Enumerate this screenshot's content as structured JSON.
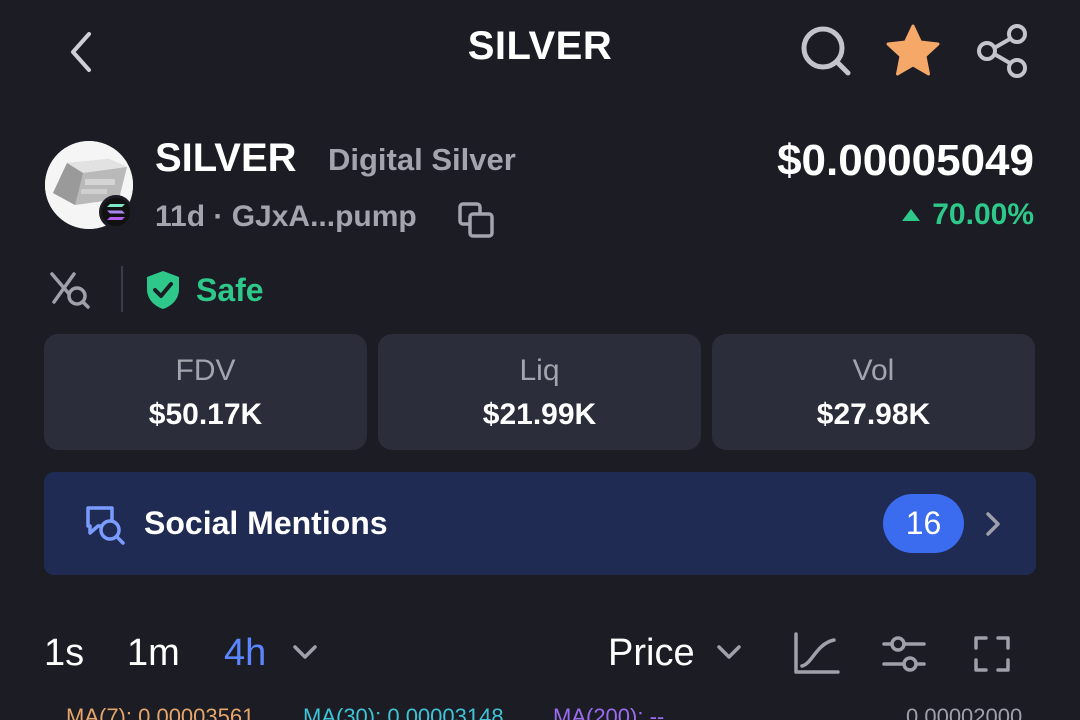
{
  "header": {
    "title": "SILVER",
    "favorite_color": "#f6a869"
  },
  "token": {
    "symbol": "SILVER",
    "name": "Digital Silver",
    "meta": "11d · GJxA...pump",
    "price": "$0.00005049",
    "change": "70.00%",
    "change_color": "#2ec98a"
  },
  "security": {
    "status": "Safe"
  },
  "stats": [
    {
      "label": "FDV",
      "value": "$50.17K"
    },
    {
      "label": "Liq",
      "value": "$21.99K"
    },
    {
      "label": "Vol",
      "value": "$27.98K"
    }
  ],
  "social": {
    "label": "Social Mentions",
    "count": "16"
  },
  "chart_controls": {
    "timeframes": [
      "1s",
      "1m",
      "4h"
    ],
    "active_timeframe": "4h",
    "mode": "Price"
  },
  "ma_legend": [
    {
      "label": "MA(7): 0.00003561",
      "color": "#e6a56a"
    },
    {
      "label": "MA(30): 0.00003148",
      "color": "#3ec4d6"
    },
    {
      "label": "MA(200): --",
      "color": "#9b6cf0"
    }
  ],
  "axis_value": "0.00002000"
}
